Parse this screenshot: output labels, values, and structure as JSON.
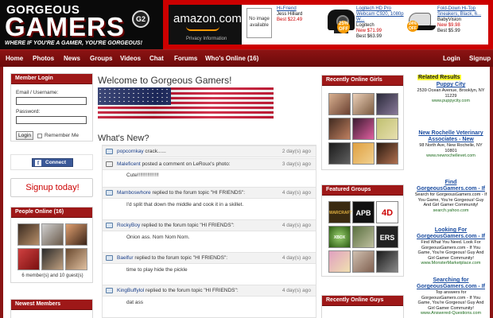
{
  "header": {
    "logo_small": "GORGEOUS",
    "logo_big": "GAMERS",
    "logo_badge": "G2",
    "tagline": "WHERE IF YOU'RE A GAMER, YOU'RE GORGEOUS!"
  },
  "ads": {
    "amazon_word": "amazon.com",
    "amazon_privacy": "Privacy Information",
    "no_image": "No image available",
    "items": [
      {
        "title": "Hi-Friend",
        "meta": "Jess Hilliard",
        "price": "Best $22.49"
      },
      {
        "title": "Logitech HD Pro Webcam C920, 1080p W...",
        "meta": "Logitech",
        "price": "New $71.99",
        "price2": "Best $63.99",
        "badge": "25% OFF"
      },
      {
        "title": "Fold-Down Hi-Top Sneakers, Black, 6...",
        "meta": "BabyVision",
        "price": "New $9.98",
        "price2": "Best $5.99",
        "badge": "24% OFF"
      }
    ]
  },
  "nav": {
    "items": [
      "Home",
      "Photos",
      "News",
      "Groups",
      "Videos",
      "Chat",
      "Forums",
      "Who's Online (16)"
    ],
    "login": "Login",
    "signup": "Signup"
  },
  "login_box": {
    "heading": "Member Login",
    "email_label": "Email / Username:",
    "password_label": "Password:",
    "login_button": "Login",
    "remember_label": "Remember Me"
  },
  "facebook": {
    "label": "Connect",
    "icon": "f"
  },
  "signup": {
    "label": "Signup today!"
  },
  "people_online": {
    "heading": "People Online (16)",
    "count_text": "6 member(s) and 10 guest(s)"
  },
  "newest_members": {
    "heading": "Newest Members"
  },
  "center": {
    "welcome": "Welcome to Gorgeous Gamers!",
    "whats_new": "What's New?"
  },
  "activity": [
    {
      "user": "popcornkay",
      "action": "crack......",
      "time": "2 day(s) ago",
      "body": ""
    },
    {
      "user": "Maleficent",
      "action": "posted a comment on LeRoux's photo:",
      "time": "3 day(s) ago",
      "body": "Cute!!!!!!!!!!!!!!!"
    },
    {
      "user": "Mamboswhore",
      "action": "replied to the forum topic \"HI FRIENDS\":",
      "time": "4 day(s) ago",
      "body": "I'd split that down the middle and cook it in a skillet."
    },
    {
      "user": "RockyBoy",
      "action": "replied to the forum topic \"HI FRIENDS\":",
      "time": "4 day(s) ago",
      "body": "Onion ass. Nom Nom Nom."
    },
    {
      "user": "Baelfur",
      "action": "replied to the forum topic \"HI FRIENDS\":",
      "time": "4 day(s) ago",
      "body": "time to play hide the pickle"
    },
    {
      "user": "KingBuffylol",
      "action": "replied to the forum topic \"HI FRIENDS\":",
      "time": "4 day(s) ago",
      "body": "dat ass"
    }
  ],
  "right": {
    "girls_heading": "Recently Online Girls",
    "groups_heading": "Featured Groups",
    "guys_heading": "Recently Online Guys",
    "group_tiles": [
      "WARCRAFT",
      "APB",
      "4D",
      "XBOX",
      "",
      "ERS",
      "",
      "",
      ""
    ]
  },
  "sponsored": {
    "label": "Related Results",
    "results": [
      {
        "title": "Puppy City",
        "lines": [
          "2539 Ocean Avenue, Brooklyn, NY 11229"
        ],
        "url": "www.puppycity.com"
      },
      {
        "title": "New Rochelle Veterinary Associates - New",
        "lines": [
          "98 North Ave, New Rochelle, NY 10801"
        ],
        "url": "www.newrochellevet.com"
      },
      {
        "title": "Find GorgeousGamers.com - If",
        "lines": [
          "Search for GorgeousGamers.com - If You Game, You're Gorgeous! Guy And Girl Gamer Community!"
        ],
        "url": "search.yahoo.com"
      },
      {
        "title": "Looking For GorgeousGamers.com - If",
        "lines": [
          "Find What You Need. Look For GorgeousGamers.com - If You Game, You're Gorgeous! Guy And Girl Gamer Community!"
        ],
        "url": "www.MonsterMarketplace.com"
      },
      {
        "title": "Searching for GorgeousGamers.com - If",
        "lines": [
          "Top answers for GorgeousGamers.com - If You Game, You're Gorgeous! Guy And Girl Gamer Community!"
        ],
        "url": "www.Answered-Questions.com"
      }
    ]
  },
  "colors": {
    "brand_red": "#cc0000",
    "nav_red": "#8c1313",
    "box_head": "#9e1818",
    "link_blue": "#1a3f8a"
  }
}
